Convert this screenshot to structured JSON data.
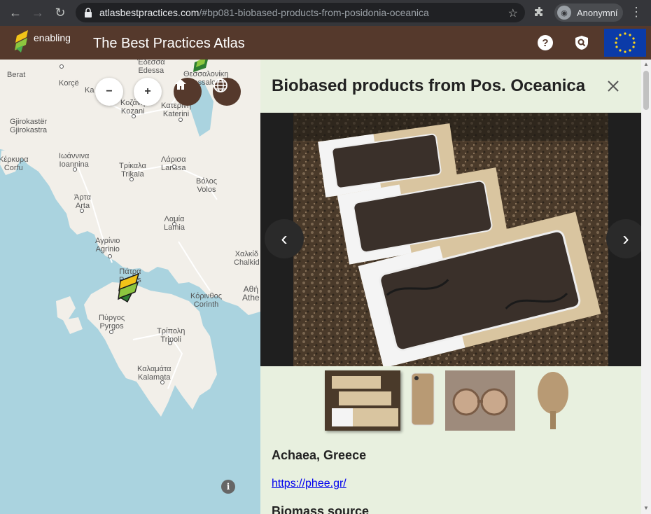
{
  "browser": {
    "url_host": "atlasbestpractices.com",
    "url_rest": "/#bp081-biobased-products-from-posidonia-oceanica",
    "profile_label": "Anonymní"
  },
  "header": {
    "logo_text": "enabling",
    "title": "The Best Practices Atlas"
  },
  "map": {
    "zoom_out": "−",
    "zoom_in": "+",
    "info": "i",
    "labels": [
      {
        "text": "Berat",
        "cls": "a"
      },
      {
        "text": "Korçë",
        "cls": "b"
      },
      {
        "text": "Ka",
        "cls": "c"
      },
      {
        "text": "Κοζάνη\nKozani",
        "cls": "d"
      },
      {
        "text": "Έδεσσα\nEdessa",
        "cls": "e"
      },
      {
        "text": "Θεσσαλονίκη\nThessaloniki",
        "cls": "f"
      },
      {
        "text": "Κατερίνη\nKaterini",
        "cls": "g"
      },
      {
        "text": "Gjirokastër\nGjirokastra",
        "cls": "h"
      },
      {
        "text": "Ιωάννινα\nIoannina",
        "cls": "i"
      },
      {
        "text": "Λάρισα\nLarissa",
        "cls": "j"
      },
      {
        "text": "Κέρκυρα\nCorfu",
        "cls": "k"
      },
      {
        "text": "Τρίκαλα\nTrikala",
        "cls": "l"
      },
      {
        "text": "Βόλος\nVolos",
        "cls": "m"
      },
      {
        "text": "Άρτα\nArta",
        "cls": "n"
      },
      {
        "text": "Λαμία\nLamia",
        "cls": "o"
      },
      {
        "text": "Αγρίνιο\nAgrinio",
        "cls": "p"
      },
      {
        "text": "Χαλκίδ\nChalkid",
        "cls": "q"
      },
      {
        "text": "Πάτρα\nPatras",
        "cls": "r"
      },
      {
        "text": "Αθή\nAthe",
        "cls": "s"
      },
      {
        "text": "Κόρινθος\nCorinth",
        "cls": "t"
      },
      {
        "text": "Πύργος\nPyrgos",
        "cls": "u"
      },
      {
        "text": "Τρίπολη\nTripoli",
        "cls": "v"
      },
      {
        "text": "Καλαμάτα\nKalamata",
        "cls": "w"
      }
    ]
  },
  "panel": {
    "title": "Biobased products from Pos. Oceanica",
    "location": "Achaea, Greece",
    "link": "https://phee.gr/",
    "section": "Biomass source"
  },
  "colors": {
    "header_bg": "#55392c",
    "panel_bg": "#e8f0df",
    "sea": "#aad3df",
    "land": "#f2efe9"
  }
}
